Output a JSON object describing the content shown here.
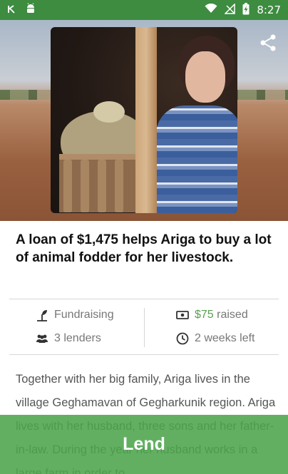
{
  "status_bar": {
    "time": "8:27",
    "icons": [
      "app-k-icon",
      "android-icon",
      "wifi-icon",
      "no-signal-icon",
      "battery-charging-icon"
    ]
  },
  "loan": {
    "title": "A loan of $1,475 helps Ariga to buy a lot of animal fodder for her livestock."
  },
  "stats": {
    "status": "Fundraising",
    "raised_amount": "$75",
    "raised_suffix": " raised",
    "lenders": "3 lenders",
    "time_left": "2 weeks left"
  },
  "description": {
    "text": "Together with her big family, Ariga lives in the village Geghamavan of Gegharkunik region. Ariga lives with her husband, three sons and her father-in-law. During the year her husband works in a large farm in order to..."
  },
  "actions": {
    "lend_label": "Lend"
  },
  "colors": {
    "status_bar": "#3d8c40",
    "accent_green": "#58a150",
    "lend_bar": "#4ca44c"
  }
}
